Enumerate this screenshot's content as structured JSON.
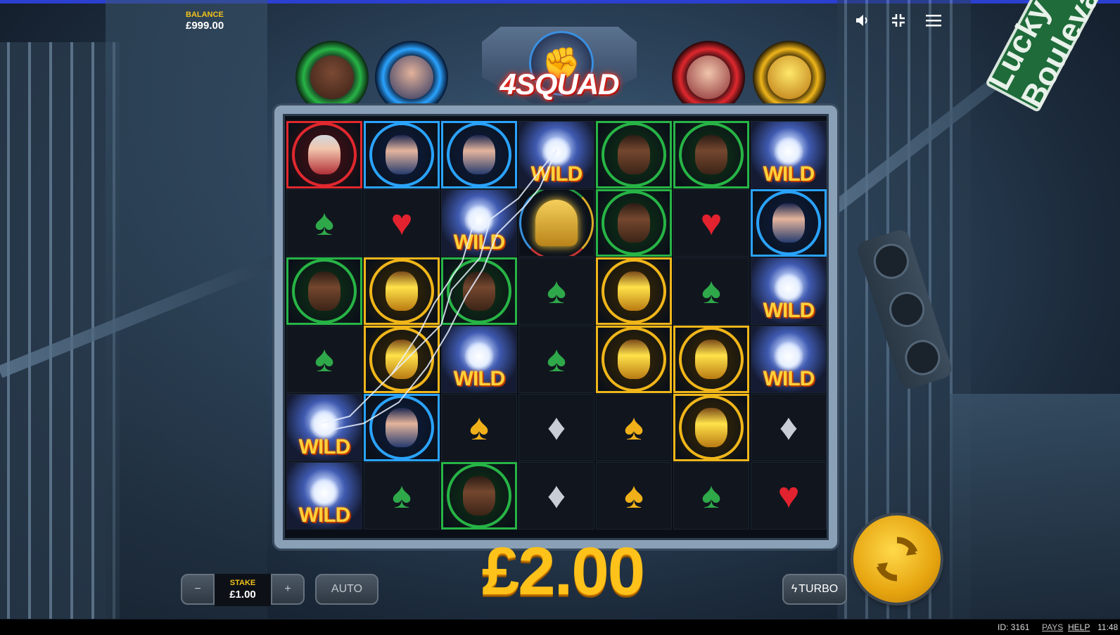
{
  "balance": {
    "label": "BALANCE",
    "value": "£999.00"
  },
  "top_icons": {
    "sound": "speaker-icon",
    "fullscreen": "exit-fullscreen-icon",
    "menu": "hamburger-menu-icon"
  },
  "logo": {
    "text": "4SQUAD"
  },
  "street_sign": "Lucky Bouleva",
  "heroes": [
    "green",
    "blue",
    "red",
    "yellow"
  ],
  "colors": {
    "green": "#27b446",
    "blue": "#2aa3ff",
    "red": "#e0282e",
    "yellow": "#f0b61a",
    "accent": "#ffc21a"
  },
  "wild_label": "WILD",
  "grid": {
    "columns": 7,
    "rows": 6,
    "cells": [
      [
        "hero-red",
        "hero-blue",
        "hero-blue",
        "wild",
        "hero-green",
        "hero-green",
        "wild"
      ],
      [
        "card-green",
        "card-red",
        "wild",
        "wild-gold",
        "hero-green",
        "card-red",
        "hero-blue"
      ],
      [
        "hero-green",
        "hero-yellow",
        "hero-green",
        "card-green",
        "hero-yellow",
        "card-green",
        "wild"
      ],
      [
        "card-green",
        "hero-yellow",
        "wild",
        "card-green",
        "hero-yellow",
        "hero-yellow",
        "wild"
      ],
      [
        "wild",
        "hero-blue",
        "card-gold",
        "card-silver",
        "card-gold",
        "hero-yellow",
        "card-silver"
      ],
      [
        "wild",
        "card-green",
        "hero-green",
        "card-silver",
        "card-gold",
        "card-green",
        "card-red"
      ]
    ]
  },
  "win_amount": "£2.00",
  "controls": {
    "minus": "−",
    "plus": "+",
    "stake_label": "STAKE",
    "stake_value": "£1.00",
    "auto": "AUTO",
    "turbo": "TURBO",
    "spin_icon": "spin-arrows-icon"
  },
  "footer": {
    "id": "ID: 3161",
    "pays": "PAYS",
    "help": "HELP",
    "time": "11:48"
  }
}
